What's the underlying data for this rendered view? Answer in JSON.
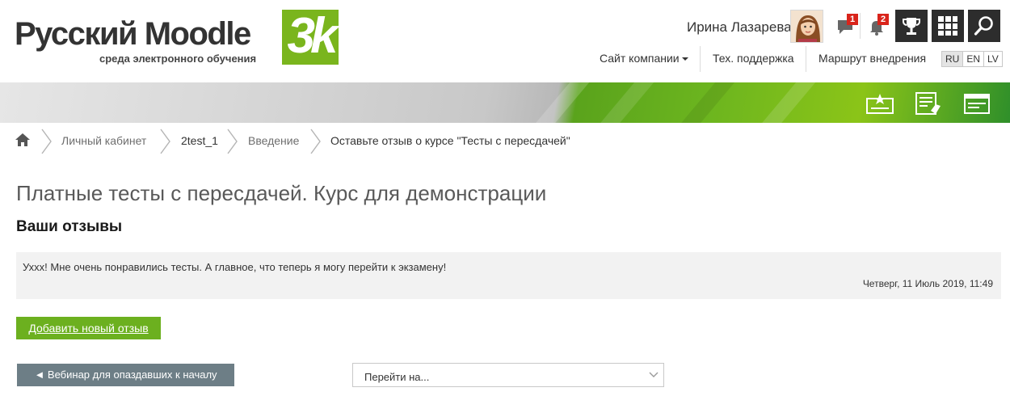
{
  "logo": {
    "main": "Русский Moodle",
    "badge": "3k",
    "subtitle": "среда электронного обучения"
  },
  "user": {
    "name": "Ирина Лазарева"
  },
  "notifications": {
    "messages_count": "1",
    "alerts_count": "2"
  },
  "topnav": {
    "company_site": "Сайт компании",
    "support": "Тех. поддержка",
    "implementation": "Маршрут внедрения",
    "languages": [
      "RU",
      "EN",
      "LV"
    ],
    "active_language": "RU"
  },
  "breadcrumb": {
    "items": [
      "Личный кабинет",
      "2test_1",
      "Введение",
      "Оставьте отзыв о курсе \"Тесты с пересдачей\""
    ]
  },
  "main": {
    "page_title": "Платные тесты с пересдачей. Курс для демонстрации",
    "section_title": "Ваши отзывы",
    "review": {
      "text": "Уххх! Мне очень понравились тесты. А главное, что теперь я могу перейти к экзамену!",
      "date": "Четверг, 11 Июль 2019, 11:49"
    },
    "add_review_label": "Добавить новый отзыв"
  },
  "footer_nav": {
    "prev_label": "◄ Вебинар для опаздавших к началу",
    "jump_placeholder": "Перейти на..."
  },
  "colors": {
    "brand_green": "#7ab51d",
    "button_green": "#6cb01f",
    "button_gray": "#6d7e86",
    "badge_red": "#d9241b",
    "dark_button": "#2d2d2d"
  },
  "icons": {
    "home": "home-icon",
    "messages": "chat-bubble-icon",
    "alerts": "bell-icon",
    "trophy": "trophy-icon",
    "apps": "grid-icon",
    "search": "search-icon",
    "banner": [
      "certificate-icon",
      "checklist-icon",
      "folder-window-icon"
    ]
  }
}
